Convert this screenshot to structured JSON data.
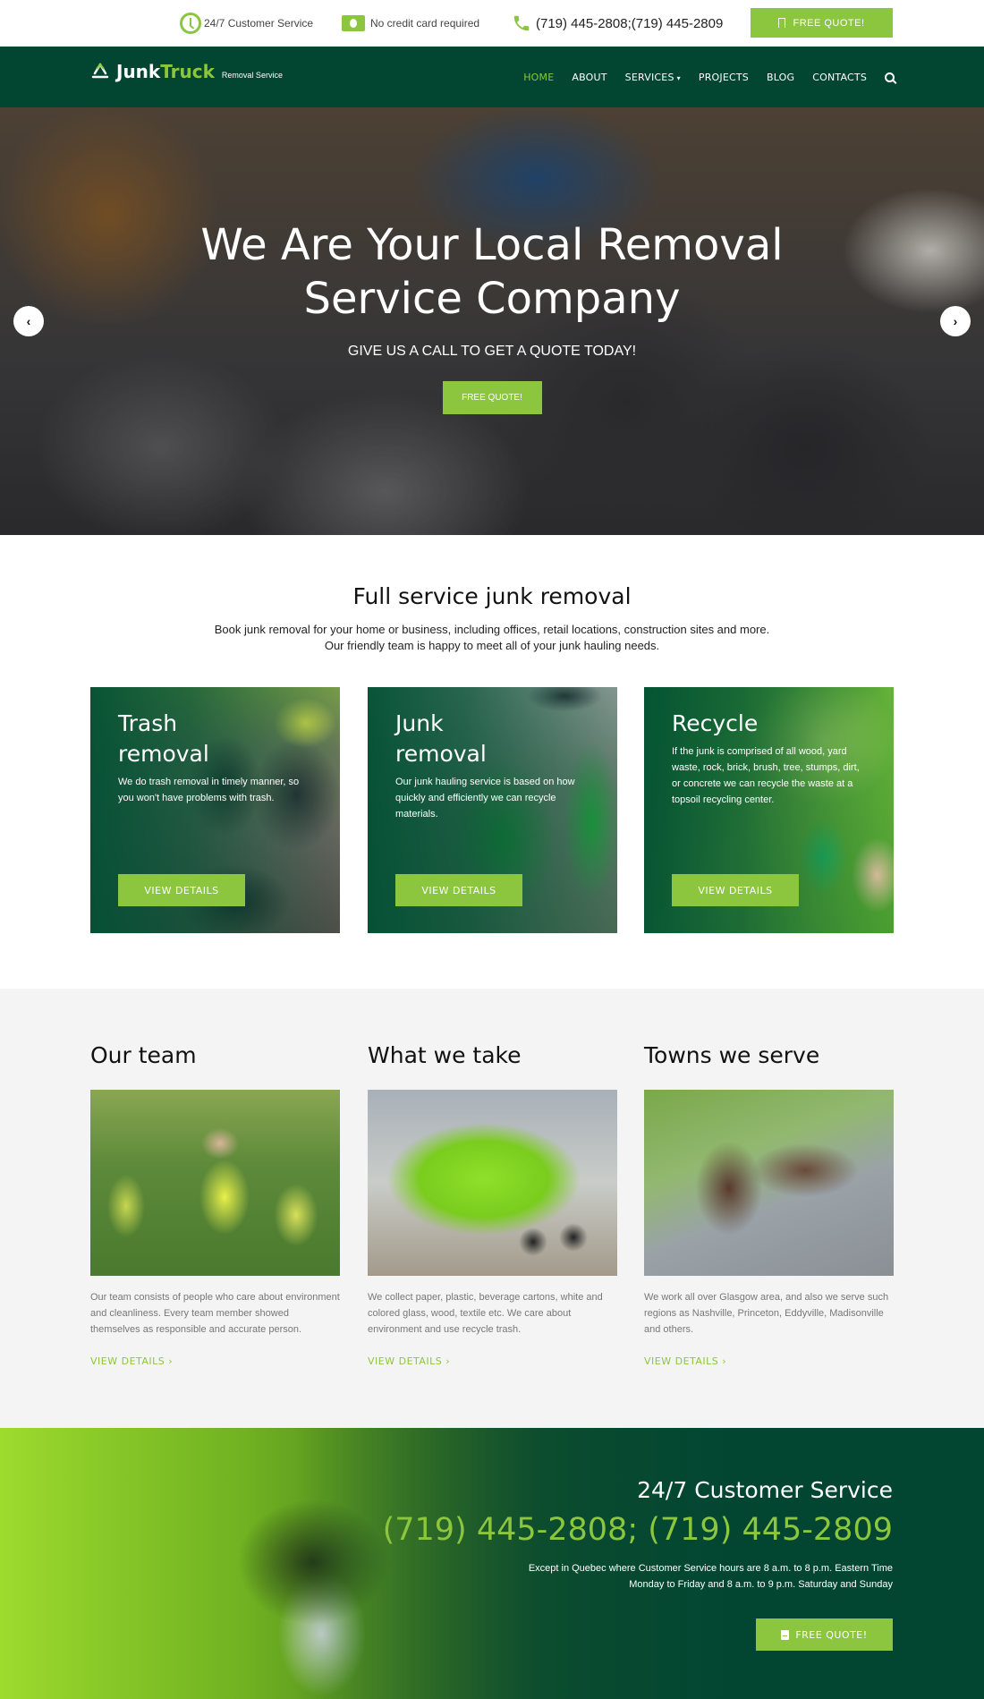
{
  "topbar": {
    "service_label": "24/7 Customer Service",
    "no_card_label": "No credit card required",
    "phones": "(719) 445-2808;(719) 445-2809",
    "quote_button": "FREE QUOTE!"
  },
  "nav": {
    "logo_part1": "Junk",
    "logo_part2": "Truck",
    "logo_sub": "Removal Service",
    "items": [
      {
        "label": "HOME",
        "active": true
      },
      {
        "label": "ABOUT"
      },
      {
        "label": "SERVICES"
      },
      {
        "label": "PROJECTS"
      },
      {
        "label": "BLOG"
      },
      {
        "label": "CONTACTS"
      }
    ]
  },
  "hero": {
    "title_line1": "We Are Your Local Removal",
    "title_line2": "Service Company",
    "subtitle": "GIVE US A CALL TO GET A QUOTE TODAY!",
    "button": "FREE QUOTE!",
    "prev_glyph": "‹",
    "next_glyph": "›"
  },
  "intro": {
    "title": "Full service junk removal",
    "line1": "Book junk removal for your home or business, including offices, retail locations, construction sites and more.",
    "line2": "Our friendly team is happy to meet all of your junk hauling needs."
  },
  "services": [
    {
      "title_line1": "Trash",
      "title_line2": "removal",
      "text": "We do trash removal in timely manner, so you won't have problems with trash.",
      "button": "VIEW DETAILS"
    },
    {
      "title_line1": "Junk",
      "title_line2": "removal",
      "text": "Our junk hauling service is based on how quickly and efficiently we can recycle materials.",
      "button": "VIEW DETAILS"
    },
    {
      "title_line1": "Recycle",
      "title_line2": "",
      "text": "If the junk is comprised of all wood, yard waste, rock, brick, brush, tree, stumps, dirt, or concrete we can recycle the waste at a topsoil recycling center.",
      "button": "VIEW DETAILS"
    }
  ],
  "features": [
    {
      "title": "Our team",
      "text": "Our team consists of people who care about environment and cleanliness. Every team member showed themselves as responsible and accurate person.",
      "link": "VIEW DETAILS"
    },
    {
      "title": "What we take",
      "text": "We collect paper, plastic, beverage cartons, white and colored glass, wood, textile etc. We care about environment and use recycle trash.",
      "link": "VIEW DETAILS"
    },
    {
      "title": "Towns we serve",
      "text": "We work all over Glasgow area, and also we serve such regions as Nashville, Princeton, Eddyville, Madisonville and others.",
      "link": "VIEW DETAILS"
    }
  ],
  "cta": {
    "title": "24/7 Customer Service",
    "phones": "(719) 445-2808; (719) 445-2809",
    "line1": "Except in Quebec where Customer Service hours are 8 a.m. to 8 p.m. Eastern Time",
    "line2": "Monday to Friday and 8 a.m. to 9 p.m. Saturday and Sunday",
    "button": "FREE QUOTE!"
  },
  "colors": {
    "brand_green": "#8cc63f",
    "dark_green": "#024632"
  }
}
